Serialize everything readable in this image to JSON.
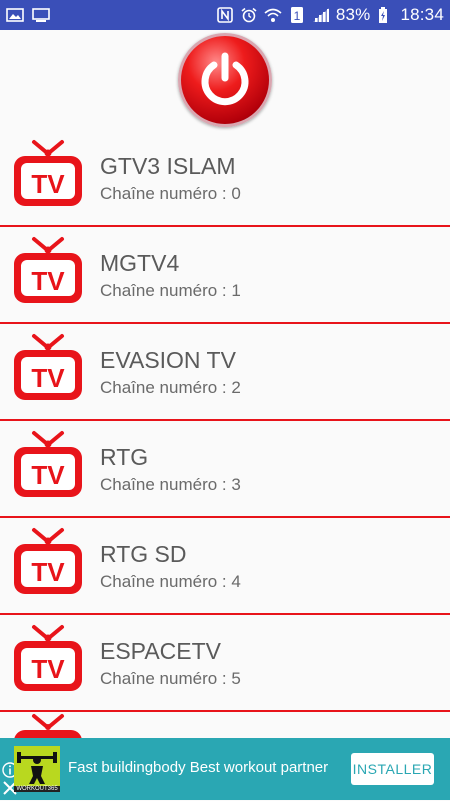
{
  "status_bar": {
    "battery_percent": "83%",
    "time": "18:34",
    "sim_badge": "1",
    "icons_left": [
      "image-icon",
      "screen-icon"
    ],
    "icons_right": [
      "nfc-icon",
      "alarm-icon",
      "wifi-icon",
      "sim-icon",
      "signal-icon",
      "battery-icon"
    ]
  },
  "header": {
    "power_icon": "power-icon",
    "accent": "#e8141a"
  },
  "channels": [
    {
      "name": "GTV3 ISLAM",
      "number_label": "Chaîne numéro : 0"
    },
    {
      "name": "MGTV4",
      "number_label": "Chaîne numéro : 1"
    },
    {
      "name": "EVASION TV",
      "number_label": "Chaîne numéro : 2"
    },
    {
      "name": "RTG",
      "number_label": "Chaîne numéro : 3"
    },
    {
      "name": "RTG SD",
      "number_label": "Chaîne numéro : 4"
    },
    {
      "name": "ESPACETV",
      "number_label": "Chaîne numéro : 5"
    }
  ],
  "tv_icon_label": "TV",
  "ad": {
    "text": "Fast buildingbody Best workout partner",
    "cta": "INSTALLER",
    "thumb_label": "WORKOUT365",
    "background": "#2aa7b3"
  }
}
